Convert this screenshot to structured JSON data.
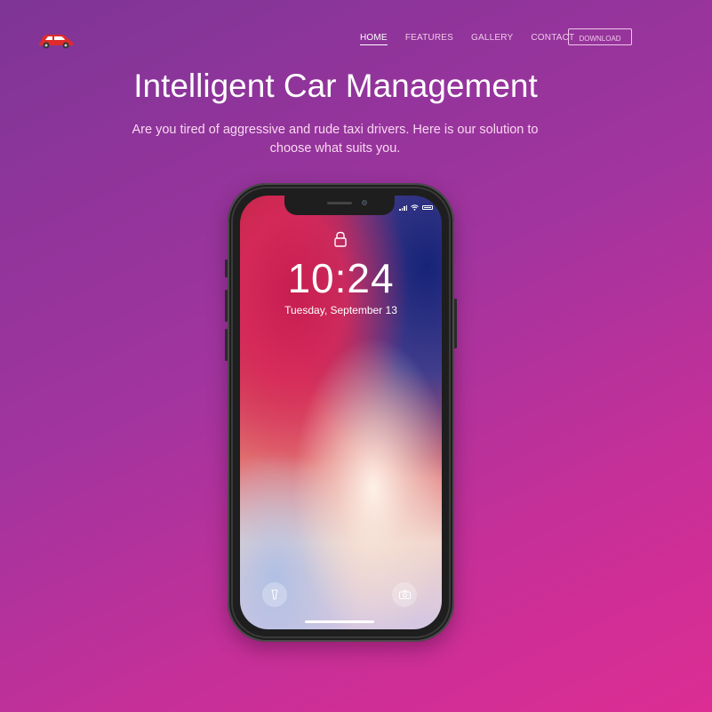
{
  "nav": {
    "logo": "car-icon",
    "links": [
      "HOME",
      "FEATURES",
      "GALLERY",
      "CONTACT"
    ],
    "download_label": "DOWNLOAD"
  },
  "hero": {
    "title": "Intelligent Car Management",
    "subtitle": "Are you tired of aggressive and rude taxi drivers. Here is our solution to choose what suits you."
  },
  "phone": {
    "time": "10:24",
    "date": "Tuesday, September 13",
    "icons": [
      "lock-icon",
      "flashlight-icon",
      "camera-icon",
      "wifi-icon",
      "battery-icon",
      "signal-icon"
    ]
  },
  "colors": {
    "accent": "#ffffff",
    "background_start": "#7e3596",
    "background_end": "#dc2d93"
  }
}
